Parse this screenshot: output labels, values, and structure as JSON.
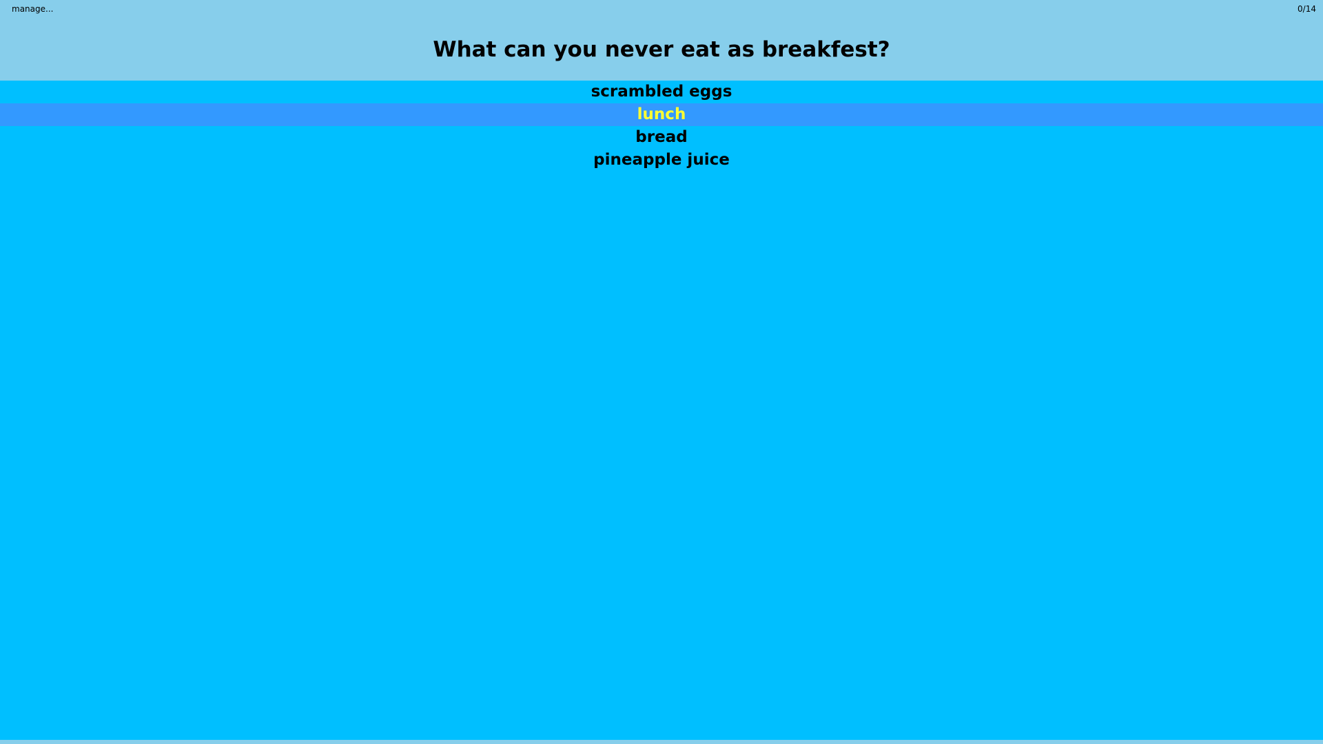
{
  "header": {
    "manage_label": "manage...",
    "counter": "0/14",
    "question": "What can you never eat as breakfest?"
  },
  "answers": [
    {
      "label": "scrambled eggs",
      "selected": false
    },
    {
      "label": "lunch",
      "selected": true
    },
    {
      "label": "bread",
      "selected": false
    },
    {
      "label": "pineapple juice",
      "selected": false
    }
  ],
  "colors": {
    "header_bg": "#87CEEB",
    "body_bg": "#00BFFF",
    "selected_bg": "#3399FF",
    "selected_text": "#FFFF33",
    "text": "#000000"
  }
}
